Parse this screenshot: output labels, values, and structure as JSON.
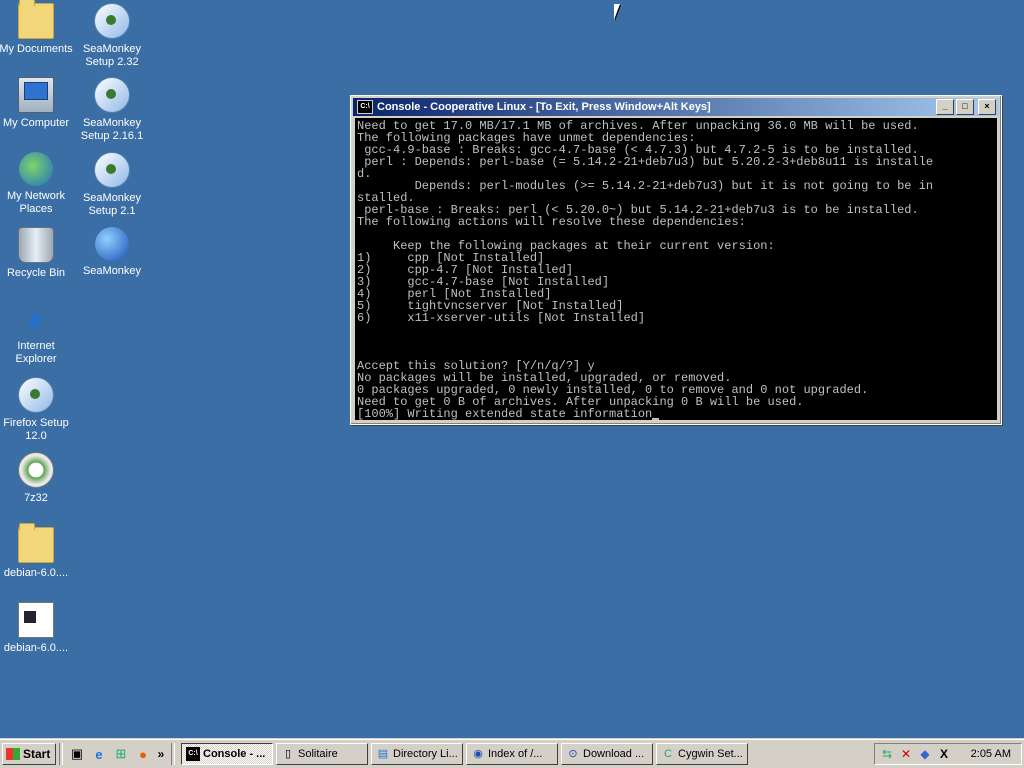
{
  "desktop": {
    "icons": [
      {
        "label": "My Documents",
        "icon": "my-documents-icon"
      },
      {
        "label": "SeaMonkey Setup 2.32",
        "icon": "installer-icon"
      },
      {
        "label": "My Computer",
        "icon": "my-computer-icon"
      },
      {
        "label": "SeaMonkey Setup 2.16.1",
        "icon": "installer-icon"
      },
      {
        "label": "My Network Places",
        "icon": "network-places-icon"
      },
      {
        "label": "SeaMonkey Setup 2.1",
        "icon": "installer-icon"
      },
      {
        "label": "Recycle Bin",
        "icon": "recycle-bin-icon"
      },
      {
        "label": "SeaMonkey",
        "icon": "seamonkey-icon"
      },
      {
        "label": "Internet Explorer",
        "icon": "internet-explorer-icon"
      },
      {
        "label": "Firefox Setup 12.0",
        "icon": "installer-icon"
      },
      {
        "label": "7z32",
        "icon": "7zip-installer-icon"
      },
      {
        "label": "debian-6.0....",
        "icon": "folder-icon"
      },
      {
        "label": "debian-6.0....",
        "icon": "file-icon"
      }
    ]
  },
  "window": {
    "title": "Console - Cooperative Linux - [To Exit, Press Window+Alt Keys]",
    "minimize": "_",
    "maximize": "□",
    "close": "×",
    "console_lines": [
      "Need to get 17.0 MB/17.1 MB of archives. After unpacking 36.0 MB will be used.",
      "The following packages have unmet dependencies:",
      " gcc-4.9-base : Breaks: gcc-4.7-base (< 4.7.3) but 4.7.2-5 is to be installed.",
      " perl : Depends: perl-base (= 5.14.2-21+deb7u3) but 5.20.2-3+deb8u11 is installe",
      "d.",
      "        Depends: perl-modules (>= 5.14.2-21+deb7u3) but it is not going to be in",
      "stalled.",
      " perl-base : Breaks: perl (< 5.20.0~) but 5.14.2-21+deb7u3 is to be installed.",
      "The following actions will resolve these dependencies:",
      "",
      "     Keep the following packages at their current version:",
      "1)     cpp [Not Installed]",
      "2)     cpp-4.7 [Not Installed]",
      "3)     gcc-4.7-base [Not Installed]",
      "4)     perl [Not Installed]",
      "5)     tightvncserver [Not Installed]",
      "6)     x11-xserver-utils [Not Installed]",
      "",
      "",
      "",
      "Accept this solution? [Y/n/q/?] y",
      "No packages will be installed, upgraded, or removed.",
      "0 packages upgraded, 0 newly installed, 0 to remove and 0 not upgraded.",
      "Need to get 0 B of archives. After unpacking 0 B will be used.",
      "[100%] Writing extended state information"
    ]
  },
  "taskbar": {
    "start_label": "Start",
    "quick_launch": [
      "show-desktop-icon",
      "internet-explorer-icon",
      "network-icon",
      "firefox-icon"
    ],
    "more": "»",
    "tasks": [
      {
        "label": "Console - ...",
        "icon": "console-icon",
        "active": true
      },
      {
        "label": "Solitaire",
        "icon": "solitaire-icon",
        "active": false
      },
      {
        "label": "Directory Li...",
        "icon": "browser-icon",
        "active": false
      },
      {
        "label": "Index of /...",
        "icon": "seamonkey-icon",
        "active": false
      },
      {
        "label": "Download ...",
        "icon": "download-icon",
        "active": false
      },
      {
        "label": "Cygwin Set...",
        "icon": "cygwin-icon",
        "active": false
      }
    ],
    "tray_icons": [
      "network-tray-icon",
      "disconnected-tray-icon",
      "mixer-tray-icon",
      "x-server-tray-icon"
    ],
    "clock": "2:05 AM"
  }
}
